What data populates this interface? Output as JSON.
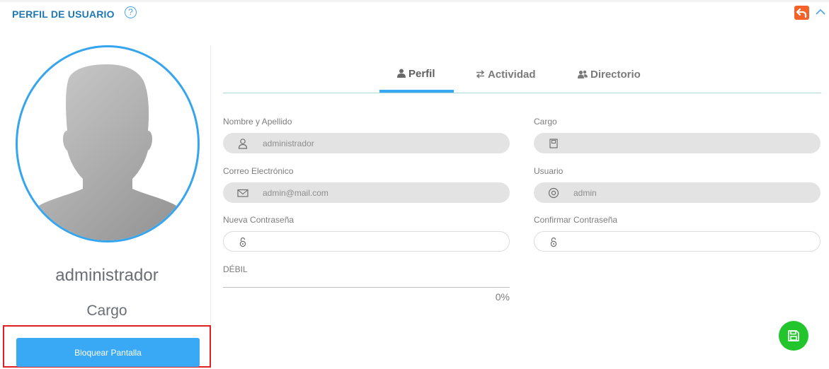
{
  "header": {
    "title": "PERFIL DE USUARIO",
    "help_symbol": "?",
    "back_icon": "undo-icon",
    "collapse_icon": "chevron-up-icon",
    "accent_color": "#1f78b4",
    "back_color": "#f4622a"
  },
  "profile": {
    "name": "administrador",
    "cargo": "Cargo",
    "lock_button": "Bloquear Pantalla",
    "avatar_icon": "user-silhouette-icon",
    "ring_color": "#36a5ee"
  },
  "tabs": [
    {
      "label": "Perfil",
      "icon": "user-icon",
      "active": true
    },
    {
      "label": "Actividad",
      "icon": "exchange-icon",
      "active": false
    },
    {
      "label": "Directorio",
      "icon": "users-icon",
      "active": false
    }
  ],
  "form": {
    "nombre": {
      "label": "Nombre y Apellido",
      "value": "administrador",
      "icon": "user-outline-icon"
    },
    "cargo": {
      "label": "Cargo",
      "value": "",
      "icon": "book-icon"
    },
    "correo": {
      "label": "Correo Electrónico",
      "value": "admin@mail.com",
      "icon": "envelope-icon"
    },
    "usuario": {
      "label": "Usuario",
      "value": "admin",
      "icon": "at-icon"
    },
    "nueva": {
      "label": "Nueva Contraseña",
      "value": "",
      "icon": "unlock-icon"
    },
    "confirmar": {
      "label": "Confirmar Contraseña",
      "value": "",
      "icon": "unlock-icon"
    },
    "strength_label": "DÉBIL",
    "strength_percent": "0%"
  },
  "save": {
    "icon": "floppy-disk-icon",
    "color": "#22c52c"
  }
}
